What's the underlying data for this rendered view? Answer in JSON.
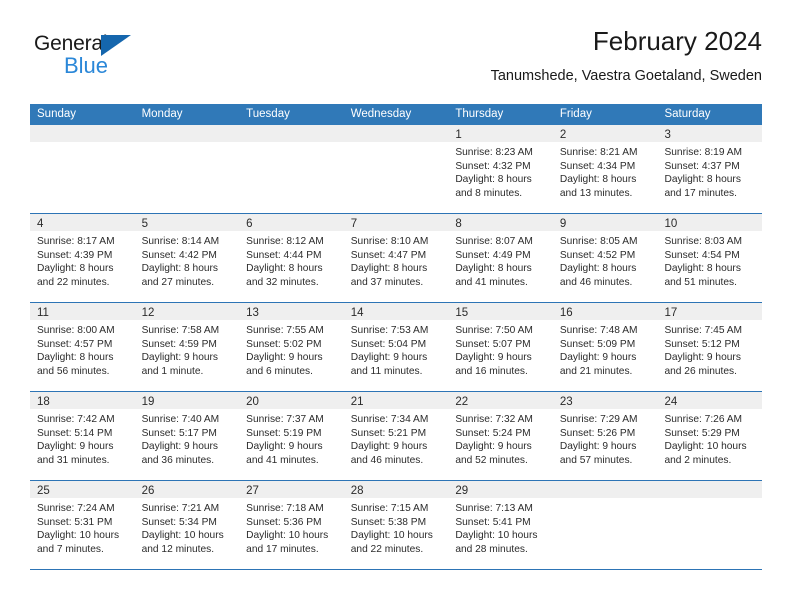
{
  "brand": {
    "name_top": "General",
    "name_bottom": "Blue",
    "triangle_color": "#1566ad",
    "blue_color": "#2a87d8"
  },
  "header": {
    "title": "February 2024",
    "location": "Tanumshede, Vaestra Goetaland, Sweden"
  },
  "theme": {
    "header_row_bg": "#3079b8",
    "week_divider": "#2d74b5",
    "daynum_strip_bg": "#efefef"
  },
  "weekdays": [
    "Sunday",
    "Monday",
    "Tuesday",
    "Wednesday",
    "Thursday",
    "Friday",
    "Saturday"
  ],
  "weeks": [
    [
      {
        "day": "",
        "empty": true
      },
      {
        "day": "",
        "empty": true
      },
      {
        "day": "",
        "empty": true
      },
      {
        "day": "",
        "empty": true
      },
      {
        "day": "1",
        "sunrise": "Sunrise: 8:23 AM",
        "sunset": "Sunset: 4:32 PM",
        "daylight": "Daylight: 8 hours and 8 minutes."
      },
      {
        "day": "2",
        "sunrise": "Sunrise: 8:21 AM",
        "sunset": "Sunset: 4:34 PM",
        "daylight": "Daylight: 8 hours and 13 minutes."
      },
      {
        "day": "3",
        "sunrise": "Sunrise: 8:19 AM",
        "sunset": "Sunset: 4:37 PM",
        "daylight": "Daylight: 8 hours and 17 minutes."
      }
    ],
    [
      {
        "day": "4",
        "sunrise": "Sunrise: 8:17 AM",
        "sunset": "Sunset: 4:39 PM",
        "daylight": "Daylight: 8 hours and 22 minutes."
      },
      {
        "day": "5",
        "sunrise": "Sunrise: 8:14 AM",
        "sunset": "Sunset: 4:42 PM",
        "daylight": "Daylight: 8 hours and 27 minutes."
      },
      {
        "day": "6",
        "sunrise": "Sunrise: 8:12 AM",
        "sunset": "Sunset: 4:44 PM",
        "daylight": "Daylight: 8 hours and 32 minutes."
      },
      {
        "day": "7",
        "sunrise": "Sunrise: 8:10 AM",
        "sunset": "Sunset: 4:47 PM",
        "daylight": "Daylight: 8 hours and 37 minutes."
      },
      {
        "day": "8",
        "sunrise": "Sunrise: 8:07 AM",
        "sunset": "Sunset: 4:49 PM",
        "daylight": "Daylight: 8 hours and 41 minutes."
      },
      {
        "day": "9",
        "sunrise": "Sunrise: 8:05 AM",
        "sunset": "Sunset: 4:52 PM",
        "daylight": "Daylight: 8 hours and 46 minutes."
      },
      {
        "day": "10",
        "sunrise": "Sunrise: 8:03 AM",
        "sunset": "Sunset: 4:54 PM",
        "daylight": "Daylight: 8 hours and 51 minutes."
      }
    ],
    [
      {
        "day": "11",
        "sunrise": "Sunrise: 8:00 AM",
        "sunset": "Sunset: 4:57 PM",
        "daylight": "Daylight: 8 hours and 56 minutes."
      },
      {
        "day": "12",
        "sunrise": "Sunrise: 7:58 AM",
        "sunset": "Sunset: 4:59 PM",
        "daylight": "Daylight: 9 hours and 1 minute."
      },
      {
        "day": "13",
        "sunrise": "Sunrise: 7:55 AM",
        "sunset": "Sunset: 5:02 PM",
        "daylight": "Daylight: 9 hours and 6 minutes."
      },
      {
        "day": "14",
        "sunrise": "Sunrise: 7:53 AM",
        "sunset": "Sunset: 5:04 PM",
        "daylight": "Daylight: 9 hours and 11 minutes."
      },
      {
        "day": "15",
        "sunrise": "Sunrise: 7:50 AM",
        "sunset": "Sunset: 5:07 PM",
        "daylight": "Daylight: 9 hours and 16 minutes."
      },
      {
        "day": "16",
        "sunrise": "Sunrise: 7:48 AM",
        "sunset": "Sunset: 5:09 PM",
        "daylight": "Daylight: 9 hours and 21 minutes."
      },
      {
        "day": "17",
        "sunrise": "Sunrise: 7:45 AM",
        "sunset": "Sunset: 5:12 PM",
        "daylight": "Daylight: 9 hours and 26 minutes."
      }
    ],
    [
      {
        "day": "18",
        "sunrise": "Sunrise: 7:42 AM",
        "sunset": "Sunset: 5:14 PM",
        "daylight": "Daylight: 9 hours and 31 minutes."
      },
      {
        "day": "19",
        "sunrise": "Sunrise: 7:40 AM",
        "sunset": "Sunset: 5:17 PM",
        "daylight": "Daylight: 9 hours and 36 minutes."
      },
      {
        "day": "20",
        "sunrise": "Sunrise: 7:37 AM",
        "sunset": "Sunset: 5:19 PM",
        "daylight": "Daylight: 9 hours and 41 minutes."
      },
      {
        "day": "21",
        "sunrise": "Sunrise: 7:34 AM",
        "sunset": "Sunset: 5:21 PM",
        "daylight": "Daylight: 9 hours and 46 minutes."
      },
      {
        "day": "22",
        "sunrise": "Sunrise: 7:32 AM",
        "sunset": "Sunset: 5:24 PM",
        "daylight": "Daylight: 9 hours and 52 minutes."
      },
      {
        "day": "23",
        "sunrise": "Sunrise: 7:29 AM",
        "sunset": "Sunset: 5:26 PM",
        "daylight": "Daylight: 9 hours and 57 minutes."
      },
      {
        "day": "24",
        "sunrise": "Sunrise: 7:26 AM",
        "sunset": "Sunset: 5:29 PM",
        "daylight": "Daylight: 10 hours and 2 minutes."
      }
    ],
    [
      {
        "day": "25",
        "sunrise": "Sunrise: 7:24 AM",
        "sunset": "Sunset: 5:31 PM",
        "daylight": "Daylight: 10 hours and 7 minutes."
      },
      {
        "day": "26",
        "sunrise": "Sunrise: 7:21 AM",
        "sunset": "Sunset: 5:34 PM",
        "daylight": "Daylight: 10 hours and 12 minutes."
      },
      {
        "day": "27",
        "sunrise": "Sunrise: 7:18 AM",
        "sunset": "Sunset: 5:36 PM",
        "daylight": "Daylight: 10 hours and 17 minutes."
      },
      {
        "day": "28",
        "sunrise": "Sunrise: 7:15 AM",
        "sunset": "Sunset: 5:38 PM",
        "daylight": "Daylight: 10 hours and 22 minutes."
      },
      {
        "day": "29",
        "sunrise": "Sunrise: 7:13 AM",
        "sunset": "Sunset: 5:41 PM",
        "daylight": "Daylight: 10 hours and 28 minutes."
      },
      {
        "day": "",
        "empty": true
      },
      {
        "day": "",
        "empty": true
      }
    ]
  ]
}
